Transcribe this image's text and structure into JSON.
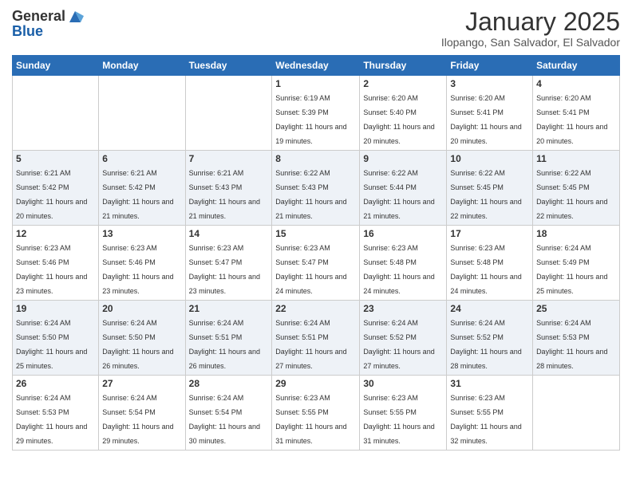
{
  "logo": {
    "general": "General",
    "blue": "Blue"
  },
  "header": {
    "month_year": "January 2025",
    "location": "Ilopango, San Salvador, El Salvador"
  },
  "days_of_week": [
    "Sunday",
    "Monday",
    "Tuesday",
    "Wednesday",
    "Thursday",
    "Friday",
    "Saturday"
  ],
  "weeks": [
    [
      {
        "day": "",
        "info": ""
      },
      {
        "day": "",
        "info": ""
      },
      {
        "day": "",
        "info": ""
      },
      {
        "day": "1",
        "info": "Sunrise: 6:19 AM\nSunset: 5:39 PM\nDaylight: 11 hours and 19 minutes."
      },
      {
        "day": "2",
        "info": "Sunrise: 6:20 AM\nSunset: 5:40 PM\nDaylight: 11 hours and 20 minutes."
      },
      {
        "day": "3",
        "info": "Sunrise: 6:20 AM\nSunset: 5:41 PM\nDaylight: 11 hours and 20 minutes."
      },
      {
        "day": "4",
        "info": "Sunrise: 6:20 AM\nSunset: 5:41 PM\nDaylight: 11 hours and 20 minutes."
      }
    ],
    [
      {
        "day": "5",
        "info": "Sunrise: 6:21 AM\nSunset: 5:42 PM\nDaylight: 11 hours and 20 minutes."
      },
      {
        "day": "6",
        "info": "Sunrise: 6:21 AM\nSunset: 5:42 PM\nDaylight: 11 hours and 21 minutes."
      },
      {
        "day": "7",
        "info": "Sunrise: 6:21 AM\nSunset: 5:43 PM\nDaylight: 11 hours and 21 minutes."
      },
      {
        "day": "8",
        "info": "Sunrise: 6:22 AM\nSunset: 5:43 PM\nDaylight: 11 hours and 21 minutes."
      },
      {
        "day": "9",
        "info": "Sunrise: 6:22 AM\nSunset: 5:44 PM\nDaylight: 11 hours and 21 minutes."
      },
      {
        "day": "10",
        "info": "Sunrise: 6:22 AM\nSunset: 5:45 PM\nDaylight: 11 hours and 22 minutes."
      },
      {
        "day": "11",
        "info": "Sunrise: 6:22 AM\nSunset: 5:45 PM\nDaylight: 11 hours and 22 minutes."
      }
    ],
    [
      {
        "day": "12",
        "info": "Sunrise: 6:23 AM\nSunset: 5:46 PM\nDaylight: 11 hours and 23 minutes."
      },
      {
        "day": "13",
        "info": "Sunrise: 6:23 AM\nSunset: 5:46 PM\nDaylight: 11 hours and 23 minutes."
      },
      {
        "day": "14",
        "info": "Sunrise: 6:23 AM\nSunset: 5:47 PM\nDaylight: 11 hours and 23 minutes."
      },
      {
        "day": "15",
        "info": "Sunrise: 6:23 AM\nSunset: 5:47 PM\nDaylight: 11 hours and 24 minutes."
      },
      {
        "day": "16",
        "info": "Sunrise: 6:23 AM\nSunset: 5:48 PM\nDaylight: 11 hours and 24 minutes."
      },
      {
        "day": "17",
        "info": "Sunrise: 6:23 AM\nSunset: 5:48 PM\nDaylight: 11 hours and 24 minutes."
      },
      {
        "day": "18",
        "info": "Sunrise: 6:24 AM\nSunset: 5:49 PM\nDaylight: 11 hours and 25 minutes."
      }
    ],
    [
      {
        "day": "19",
        "info": "Sunrise: 6:24 AM\nSunset: 5:50 PM\nDaylight: 11 hours and 25 minutes."
      },
      {
        "day": "20",
        "info": "Sunrise: 6:24 AM\nSunset: 5:50 PM\nDaylight: 11 hours and 26 minutes."
      },
      {
        "day": "21",
        "info": "Sunrise: 6:24 AM\nSunset: 5:51 PM\nDaylight: 11 hours and 26 minutes."
      },
      {
        "day": "22",
        "info": "Sunrise: 6:24 AM\nSunset: 5:51 PM\nDaylight: 11 hours and 27 minutes."
      },
      {
        "day": "23",
        "info": "Sunrise: 6:24 AM\nSunset: 5:52 PM\nDaylight: 11 hours and 27 minutes."
      },
      {
        "day": "24",
        "info": "Sunrise: 6:24 AM\nSunset: 5:52 PM\nDaylight: 11 hours and 28 minutes."
      },
      {
        "day": "25",
        "info": "Sunrise: 6:24 AM\nSunset: 5:53 PM\nDaylight: 11 hours and 28 minutes."
      }
    ],
    [
      {
        "day": "26",
        "info": "Sunrise: 6:24 AM\nSunset: 5:53 PM\nDaylight: 11 hours and 29 minutes."
      },
      {
        "day": "27",
        "info": "Sunrise: 6:24 AM\nSunset: 5:54 PM\nDaylight: 11 hours and 29 minutes."
      },
      {
        "day": "28",
        "info": "Sunrise: 6:24 AM\nSunset: 5:54 PM\nDaylight: 11 hours and 30 minutes."
      },
      {
        "day": "29",
        "info": "Sunrise: 6:23 AM\nSunset: 5:55 PM\nDaylight: 11 hours and 31 minutes."
      },
      {
        "day": "30",
        "info": "Sunrise: 6:23 AM\nSunset: 5:55 PM\nDaylight: 11 hours and 31 minutes."
      },
      {
        "day": "31",
        "info": "Sunrise: 6:23 AM\nSunset: 5:55 PM\nDaylight: 11 hours and 32 minutes."
      },
      {
        "day": "",
        "info": ""
      }
    ]
  ]
}
